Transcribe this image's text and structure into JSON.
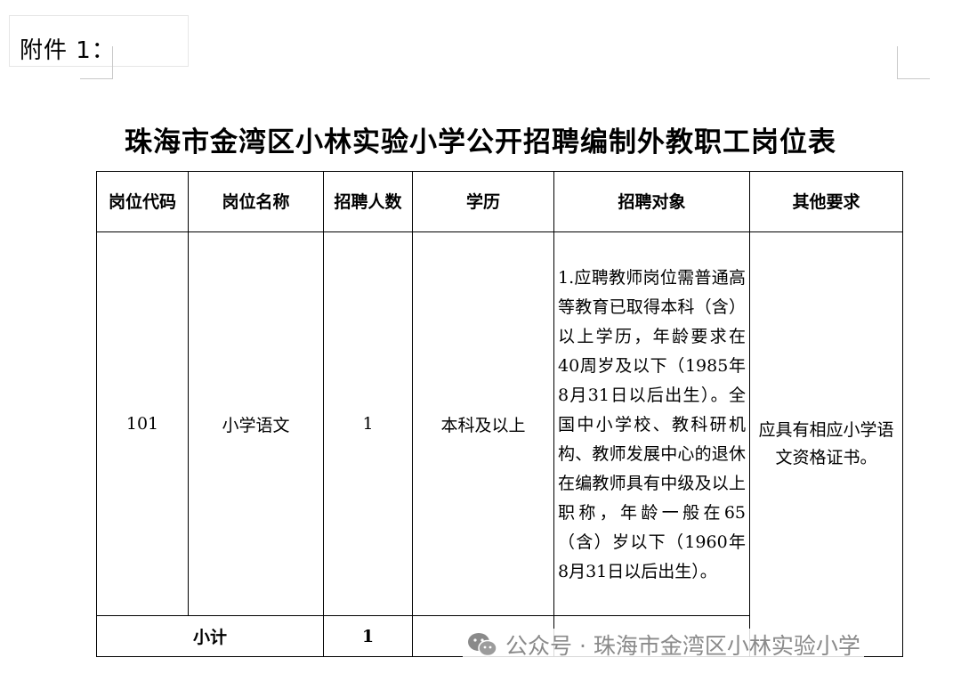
{
  "attachment_label": "附件 1：",
  "title": "珠海市金湾区小林实验小学公开招聘编制外教职工岗位表",
  "table": {
    "headers": {
      "code": "岗位代码",
      "name": "岗位名称",
      "count": "招聘人数",
      "education": "学历",
      "target": "招聘对象",
      "other": "其他要求"
    },
    "rows": [
      {
        "code": "101",
        "name": "小学语文",
        "count": "1",
        "education": "本科及以上",
        "target": "1.应聘教师岗位需普通高等教育已取得本科（含）以上学历，年龄要求在40周岁及以下（1985年8月31日以后出生）。全国中小学校、教科研机构、教师发展中心的退休在编教师具有中级及以上职称，年龄一般在65（含）岁以下（1960年8月31日以后出生）。",
        "other": "应具有相应小学语文资格证书。"
      }
    ],
    "subtotal": {
      "label": "小计",
      "count": "1"
    }
  },
  "watermark": {
    "icon": "wechat-icon",
    "text": "公众号 · 珠海市金湾区小林实验小学"
  }
}
